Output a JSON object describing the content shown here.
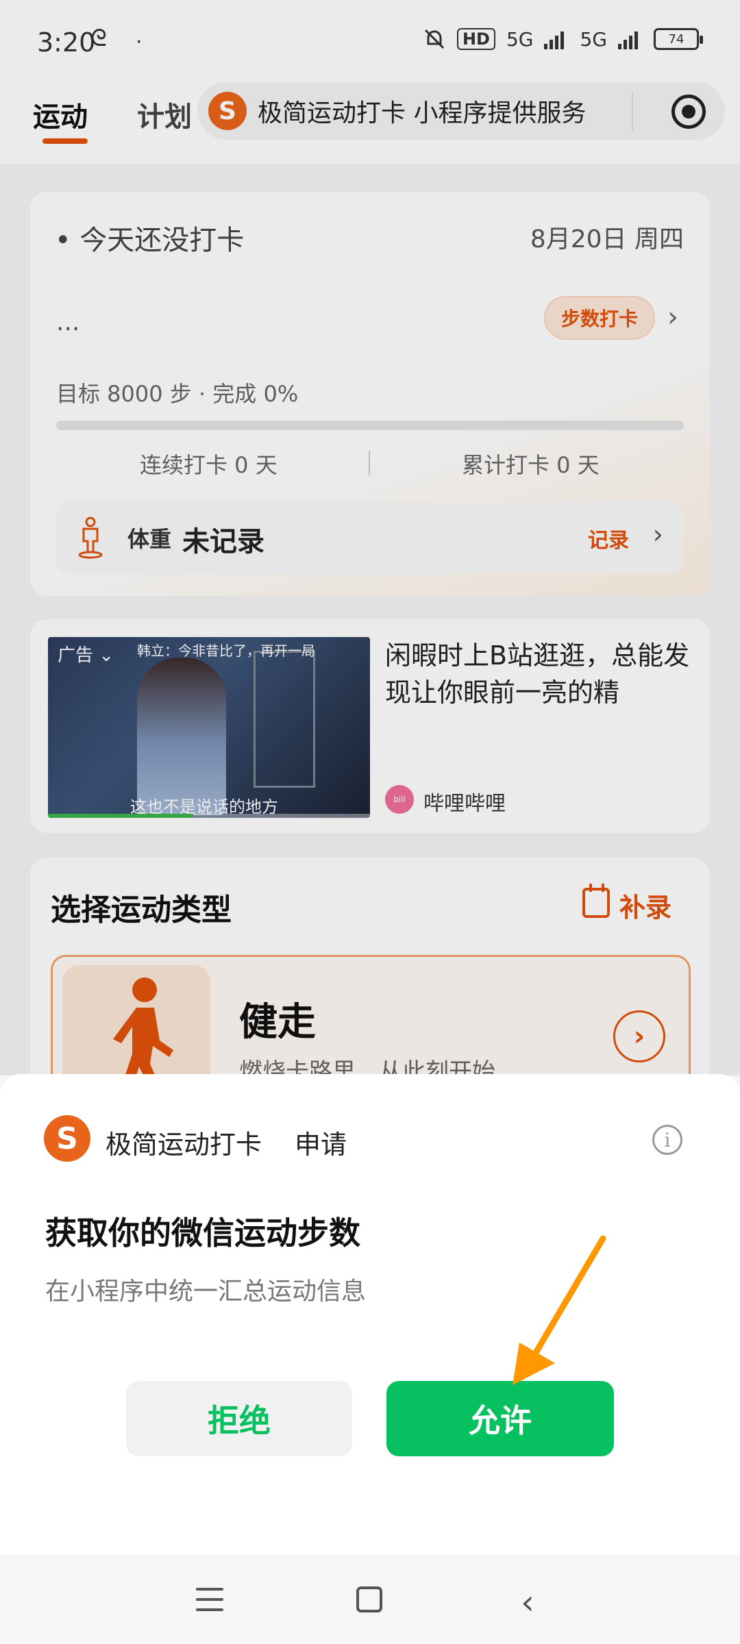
{
  "status_bar": {
    "time": "3:20",
    "time_extra": "ᘓ",
    "dot": "·",
    "hd": "HD",
    "net1": "5G",
    "net2": "5G",
    "battery": "74"
  },
  "nav": {
    "tab_active": "运动",
    "tab_plan": "计划",
    "service_logo": "S",
    "service_text": "极简运动打卡 小程序提供服务"
  },
  "checkin": {
    "status": "今天还没打卡",
    "date": "8月20日 周四",
    "ellipsis": "...",
    "step_button": "步数打卡",
    "goal": "目标 8000 步 · 完成 0%",
    "progress": 0,
    "streak": "连续打卡 0 天",
    "total": "累计打卡 0 天",
    "weight_label": "体重",
    "weight_value": "未记录",
    "record_link": "记录"
  },
  "ad": {
    "tag": "广告 ⌄",
    "subtitle_top": "韩立：今非昔比了，再开一局",
    "subtitle": "这也不是说话的地方",
    "text": "闲暇时上B站逛逛，总能发现让你眼前一亮的精",
    "source_icon": "bili",
    "source": "哔哩哔哩"
  },
  "sport": {
    "title": "选择运动类型",
    "supplement": "补录",
    "walk_name": "健走",
    "walk_desc": "燃烧卡路里，从此刻开始"
  },
  "sheet": {
    "logo": "S",
    "app_name": "极简运动打卡",
    "request": "申请",
    "info": "i",
    "title": "获取你的微信运动步数",
    "desc": "在小程序中统一汇总运动信息",
    "reject": "拒绝",
    "allow": "允许"
  },
  "colors": {
    "accent": "#e2520a",
    "wechat_green": "#07c160",
    "annotation_arrow": "#ff9800"
  }
}
